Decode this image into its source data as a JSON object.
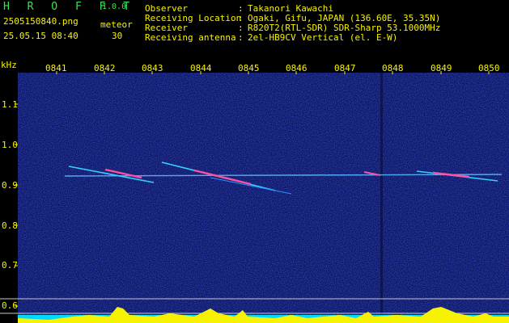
{
  "header": {
    "app_name": "H R O F F T",
    "version": "1.0.0",
    "filename": "2505150840.png",
    "datetime": "25.05.15 08:40",
    "meteor_label": "meteor",
    "meteor_count": "30"
  },
  "info": [
    {
      "key": "Observer",
      "sep": ":",
      "value": "Takanori Kawachi"
    },
    {
      "key": "Receiving Location",
      "sep": ":",
      "value": "Ogaki, Gifu, JAPAN (136.60E, 35.35N)"
    },
    {
      "key": "Receiver",
      "sep": ":",
      "value": "R820T2(RTL-SDR) SDR-Sharp 53.1000MHz"
    },
    {
      "key": "Receiving antenna",
      "sep": ":",
      "value": "2el-HB9CV Vertical (el. E-W)"
    }
  ],
  "yaxis": {
    "unit": "kHz",
    "ticks": [
      "1.1",
      "1.0",
      "0.9",
      "0.8",
      "0.7",
      "0.6"
    ]
  },
  "xaxis": {
    "ticks": [
      "0841",
      "0842",
      "0843",
      "0844",
      "0845",
      "0846",
      "0847",
      "0848",
      "0849",
      "0850"
    ]
  },
  "colors": {
    "background": "#000000",
    "spectrogram": "#0a1a6a",
    "label_yellow": "#f6f200",
    "title_green": "#35e84a",
    "cyan_bar": "#00d8ff"
  }
}
